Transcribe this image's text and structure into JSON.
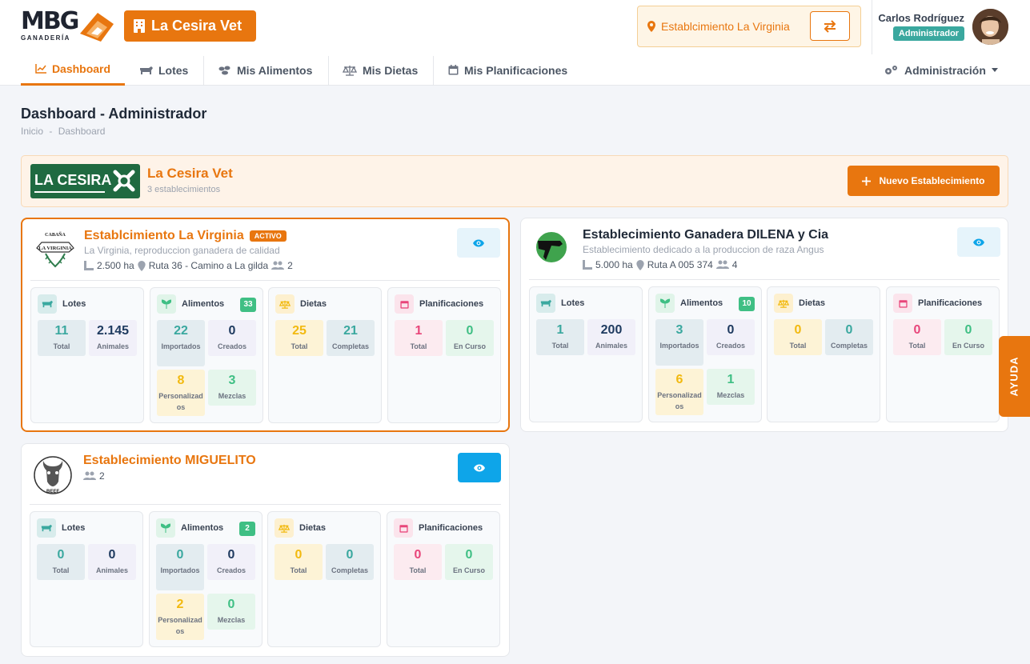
{
  "brand": {
    "top": "MBG",
    "sub": "GANADERÍA"
  },
  "org": {
    "name": "La Cesira Vet"
  },
  "current_establishment": "Establcimiento La Virginia",
  "user": {
    "name": "Carlos Rodríguez",
    "role": "Administrador"
  },
  "nav": {
    "items": [
      "Dashboard",
      "Lotes",
      "Mis Alimentos",
      "Mis Dietas",
      "Mis Planificaciones"
    ],
    "admin": "Administración"
  },
  "page": {
    "title": "Dashboard - Administrador",
    "breadcrumb": [
      "Inicio",
      "Dashboard"
    ],
    "breadcrumb_sep": "-"
  },
  "banner": {
    "logo_text": "LA CESIRA",
    "name": "La Cesira Vet",
    "subtitle": "3 establecimientos",
    "new_button": "Nuevo Establecimiento"
  },
  "labels": {
    "lotes": "Lotes",
    "alimentos": "Alimentos",
    "dietas": "Dietas",
    "planificaciones": "Planificaciones",
    "total": "Total",
    "animales": "Animales",
    "importados": "Importados",
    "creados": "Creados",
    "personalizados": "Personalizados",
    "mezclas": "Mezclas",
    "completas": "Completas",
    "en_curso": "En Curso"
  },
  "establishments": [
    {
      "name": "Establcimiento La Virginia",
      "badge": "ACTIVO",
      "description": "La Virginia, reproduccion ganadera de calidad",
      "area": "2.500 ha",
      "location": "Ruta 36 - Camino a La gilda",
      "users": "2",
      "logo_text": [
        "CABAÑA",
        "LA VIRGINIA"
      ],
      "lotes": {
        "total": "11",
        "animales": "2.145"
      },
      "alimentos": {
        "count": "33",
        "importados": "22",
        "creados": "0",
        "personalizados": "8",
        "mezclas": "3"
      },
      "dietas": {
        "total": "25",
        "completas": "21"
      },
      "planificaciones": {
        "total": "1",
        "en_curso": "0"
      }
    },
    {
      "name": "Establecimiento Ganadera DILENA y Cia",
      "badge": "",
      "description": "Establecimiento dedicado a la produccion de raza Angus",
      "area": "5.000 ha",
      "location": "Ruta A 005 374",
      "users": "4",
      "lotes": {
        "total": "1",
        "animales": "200"
      },
      "alimentos": {
        "count": "10",
        "importados": "3",
        "creados": "0",
        "personalizados": "6",
        "mezclas": "1"
      },
      "dietas": {
        "total": "0",
        "completas": "0"
      },
      "planificaciones": {
        "total": "0",
        "en_curso": "0"
      }
    },
    {
      "name": "Establecimiento MIGUELITO",
      "badge": "",
      "description": "",
      "area": "",
      "location": "",
      "users": "2",
      "logo_text": [
        "BEEF"
      ],
      "lotes": {
        "total": "0",
        "animales": "0"
      },
      "alimentos": {
        "count": "2",
        "importados": "0",
        "creados": "0",
        "personalizados": "2",
        "mezclas": "0"
      },
      "dietas": {
        "total": "0",
        "completas": "0"
      },
      "planificaciones": {
        "total": "0",
        "en_curso": "0"
      }
    }
  ],
  "help": "AYUDA",
  "colors": {
    "accent": "#e8760f",
    "teal": "#3aa89f",
    "green": "#3fbf84",
    "blue": "#0ea5e9",
    "pink": "#e8457a",
    "yellow": "#f2b90f",
    "navy": "#1e3a5f"
  }
}
